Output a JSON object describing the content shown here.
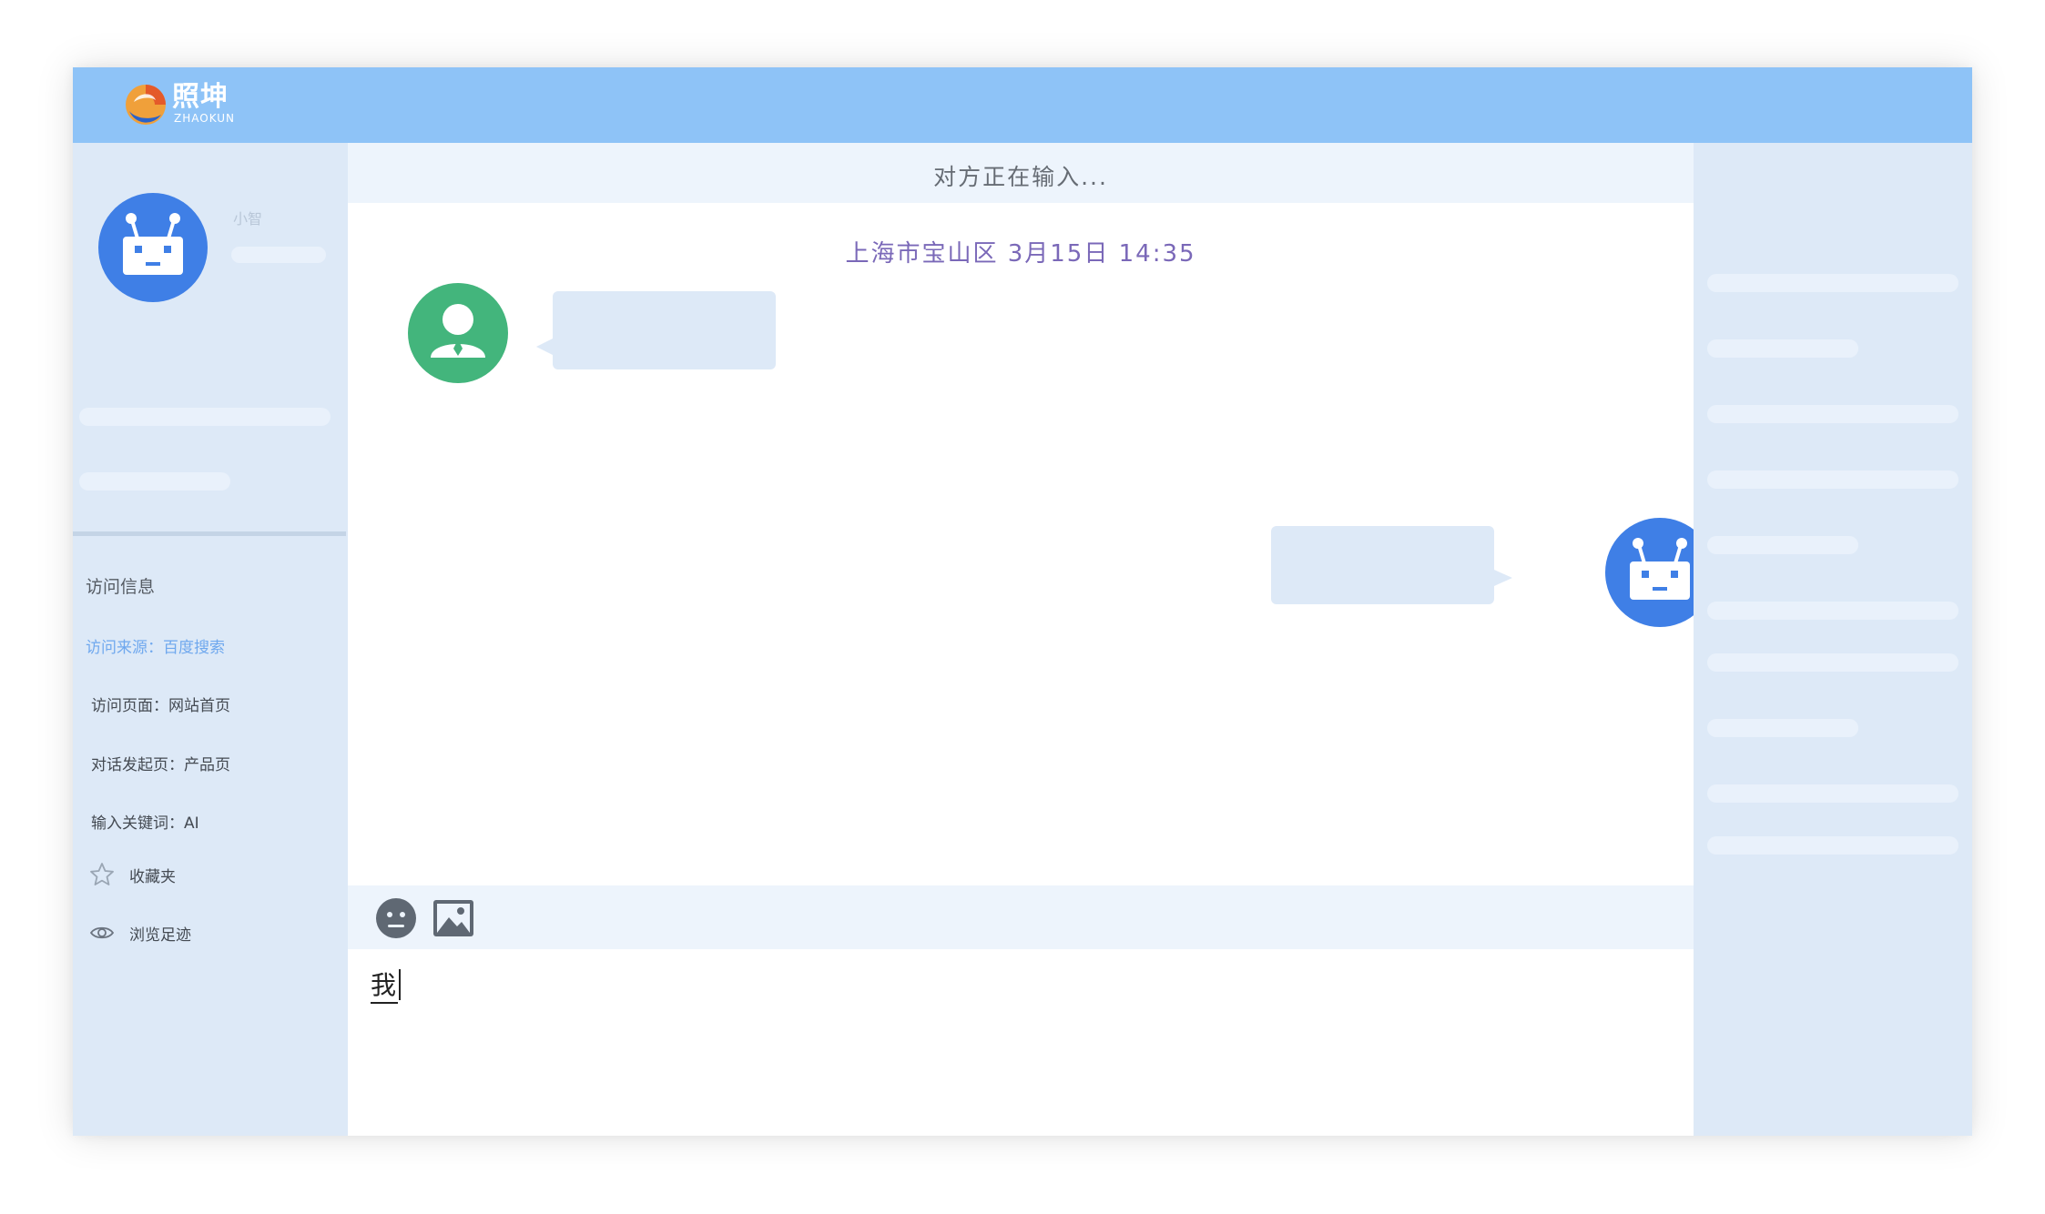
{
  "brand": {
    "name_cn": "照坤",
    "name_en": "ZHAOKUN"
  },
  "agent": {
    "name": "小智"
  },
  "visit_info": {
    "title": "访问信息",
    "source": "访问来源：百度搜索",
    "page": "访问页面：网站首页",
    "start_page": "对话发起页：产品页",
    "keyword": "输入关键词：AI"
  },
  "nav": {
    "favorites": "收藏夹",
    "history": "浏览足迹"
  },
  "chat": {
    "typing_status": "对方正在输入...",
    "timestamp": "上海市宝山区 3月15日  14:35"
  },
  "input": {
    "value": "我"
  },
  "icons": {
    "logo": "zhaokun-logo-icon",
    "agent_avatar": "robot-icon",
    "user_avatar": "user-icon",
    "favorites": "star-icon",
    "history": "eye-icon",
    "emoji": "emoji-icon",
    "image": "image-icon"
  },
  "colors": {
    "topbar": "#8ec3f7",
    "panel": "#dde9f7",
    "accent_blue": "#3f7fe6",
    "user_green": "#43b57c",
    "timestamp_purple": "#7a68b8",
    "source_link": "#6fa8ee"
  }
}
